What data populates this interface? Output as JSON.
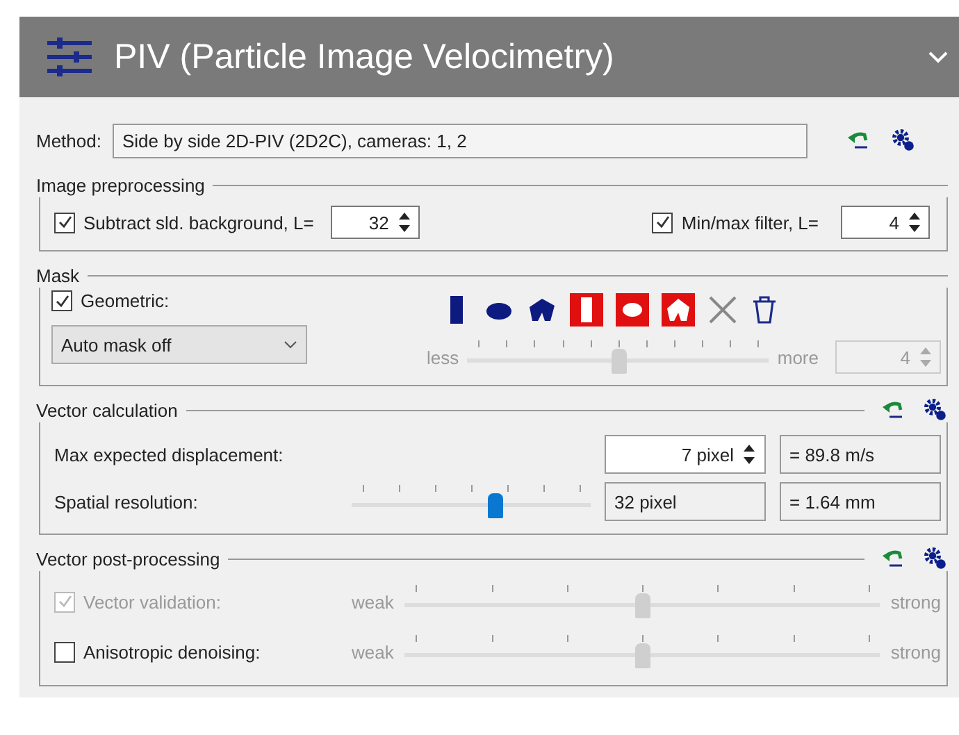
{
  "header": {
    "title": "PIV (Particle Image Velocimetry)"
  },
  "method": {
    "label": "Method:",
    "value": "Side by side 2D-PIV (2D2C), cameras: 1, 2"
  },
  "image_preprocessing": {
    "title": "Image preprocessing",
    "controls": [
      {
        "label": "Subtract sld. background, L=",
        "checked": true,
        "value": "32"
      },
      {
        "label": "Min/max filter, L=",
        "checked": true,
        "value": "4"
      }
    ]
  },
  "mask": {
    "title": "Mask",
    "geometric": {
      "label": "Geometric:",
      "checked": true
    },
    "auto_mask": {
      "value": "Auto mask off"
    },
    "slider": {
      "left": "less",
      "right": "more",
      "level": 0.5,
      "disabled": true
    },
    "spin": {
      "value": "4",
      "disabled": true
    }
  },
  "vector_calculation": {
    "title": "Vector calculation",
    "rows": [
      {
        "kind": "spin",
        "label": "Max expected displacement:",
        "value": "7 pixel",
        "result": "= 89.8 m/s"
      },
      {
        "kind": "slider",
        "label": "Spatial resolution:",
        "level": 0.6,
        "value": "32 pixel",
        "result": "= 1.64 mm"
      }
    ]
  },
  "vector_post_processing": {
    "title": "Vector post-processing",
    "rows": [
      {
        "label": "Vector validation:",
        "checked": true,
        "disabled": true,
        "left": "weak",
        "right": "strong",
        "level": 0.5
      },
      {
        "label": "Anisotropic denoising:",
        "checked": false,
        "disabled": false,
        "left": "weak",
        "right": "strong",
        "level": 0.5
      }
    ]
  }
}
